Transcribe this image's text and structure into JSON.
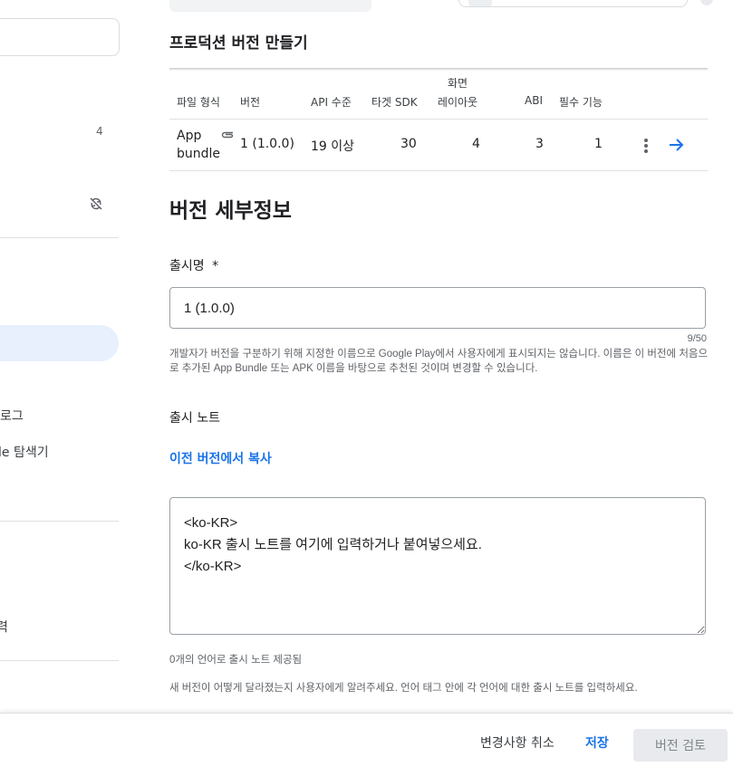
{
  "sidebar": {
    "count_badge": "4",
    "items": [
      {
        "label": "로그"
      },
      {
        "label": "le 탐색기"
      },
      {
        "label": "력"
      }
    ]
  },
  "release": {
    "title": "프로덕션 버전 만들기",
    "table": {
      "headers": {
        "file_type": "파일 형식",
        "version": "버전",
        "api_level": "API 수준",
        "target_sdk": "타겟 SDK",
        "screen_layout_line1": "화면",
        "screen_layout_line2": "레이아웃",
        "abi": "ABI",
        "required_features": "필수 기능"
      },
      "rows": [
        {
          "file_type_line1": "App",
          "file_type_line2": "bundle",
          "version": "1 (1.0.0)",
          "api_level": "19 이상",
          "target_sdk": "30",
          "screen_layout": "4",
          "abi": "3",
          "required_features": "1"
        }
      ]
    }
  },
  "details": {
    "title": "버전 세부정보",
    "release_name": {
      "label": "출시명",
      "required_mark": "*",
      "value": "1 (1.0.0)",
      "counter": "9/50",
      "helper": "개발자가 버전을 구분하기 위해 지정한 이름으로 Google Play에서 사용자에게 표시되지는 않습니다. 이름은 이 버전에 처음으로 추가된 App Bundle 또는 APK 이름을 바탕으로 추천된 것이며 변경할 수 있습니다."
    },
    "release_notes": {
      "label": "출시 노트",
      "copy_link": "이전 버전에서 복사",
      "value": "<ko-KR>\nko-KR 출시 노트를 여기에 입력하거나 붙여넣으세요.\n</ko-KR>",
      "languages_status": "0개의 언어로 출시 노트 제공됨",
      "helper": "새 버전이 어떻게 달라졌는지 사용자에게 알려주세요. 언어 태그 안에 각 언어에 대한 출시 노트를 입력하세요."
    }
  },
  "actions": {
    "discard": "변경사항 취소",
    "save": "저장",
    "review": "버전 검토"
  },
  "colors": {
    "accent": "#1a73e8",
    "active_nav": "#e8f0fe",
    "border": "#9aa0a6",
    "divider": "#e0e0e0",
    "disabled_bg": "#e8eaed"
  }
}
